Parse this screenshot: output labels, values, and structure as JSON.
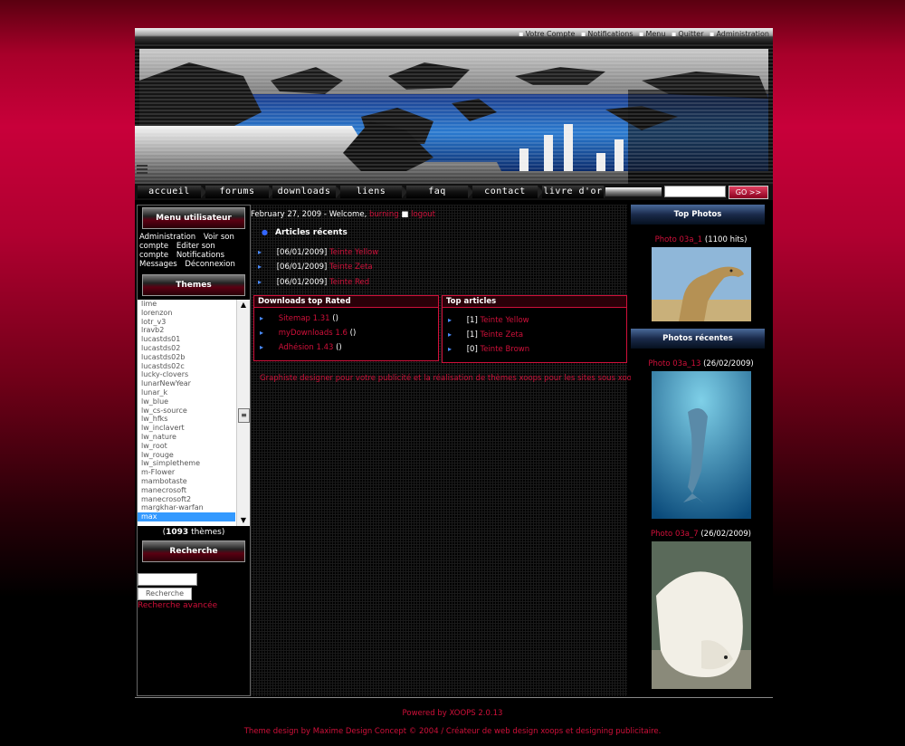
{
  "toplinks": [
    "Votre Compte",
    "Notifications",
    "Menu",
    "Quitter",
    "Administration"
  ],
  "nav": {
    "items": [
      "accueil",
      "forums",
      "downloads",
      "liens",
      "faq",
      "contact",
      "livre d'or"
    ],
    "search_button": "GO >>"
  },
  "left": {
    "usermenu_title": "Menu utilisateur",
    "usermenu_items": [
      "Administration",
      "Voir son compte",
      "Editer son compte",
      "Notifications",
      "Messages",
      "Déconnexion"
    ],
    "themes_title": "Themes",
    "themes": [
      "lime",
      "lorenzon",
      "lotr_v3",
      "lravb2",
      "lucastds01",
      "lucastds02",
      "lucastds02b",
      "lucastds02c",
      "lucky-clovers",
      "lunarNewYear",
      "lunar_k",
      "lw_blue",
      "lw_cs-source",
      "lw_hfks",
      "lw_inclavert",
      "lw_nature",
      "lw_root",
      "lw_rouge",
      "lw_simpletheme",
      "m-Flower",
      "mambotaste",
      "manecrosoft",
      "manecrosoft2",
      "margkhar-warfan",
      "max"
    ],
    "themes_selected": "max",
    "themes_count": "1093",
    "themes_count_label": "thèmes",
    "search_title": "Recherche",
    "search_button": "Recherche",
    "advanced_search": "Recherche avancée"
  },
  "center": {
    "date": "February 27, 2009 - Welcome,",
    "username": "burning",
    "logout": "logout",
    "recent_title": "Articles récents",
    "recent": [
      {
        "date": "[06/01/2009]",
        "title": "Teinte Yellow"
      },
      {
        "date": "[06/01/2009]",
        "title": "Teinte Zeta"
      },
      {
        "date": "[06/01/2009]",
        "title": "Teinte Red"
      }
    ],
    "downloads_title": "Downloads top Rated",
    "downloads": [
      {
        "name": "Sitemap 1.31",
        "extra": "()"
      },
      {
        "name": "myDownloads 1.6",
        "extra": "()"
      },
      {
        "name": "Adhésion 1.43",
        "extra": "()"
      }
    ],
    "top_articles_title": "Top articles",
    "top_articles": [
      {
        "count": "[1]",
        "title": "Teinte Yellow"
      },
      {
        "count": "[1]",
        "title": "Teinte Zeta"
      },
      {
        "count": "[0]",
        "title": "Teinte Brown"
      }
    ],
    "promo": "Graphiste designer pour votre publicité et la réalisation de thèmes xoops pour les sites sous xoops"
  },
  "right": {
    "top_photos_title": "Top Photos",
    "top_photo": {
      "name": "Photo 03a_1",
      "info": "(1100 hits)"
    },
    "recent_photos_title": "Photos récentes",
    "recent_photos": [
      {
        "name": "Photo 03a_13",
        "info": "(26/02/2009)"
      },
      {
        "name": "Photo 03a_7",
        "info": "(26/02/2009)"
      }
    ]
  },
  "footer": {
    "powered": "Powered by XOOPS 2.0.13",
    "credit": "Theme design by Maxime Design Concept © 2004 / Créateur de web design xoops et designing publicitaire."
  }
}
